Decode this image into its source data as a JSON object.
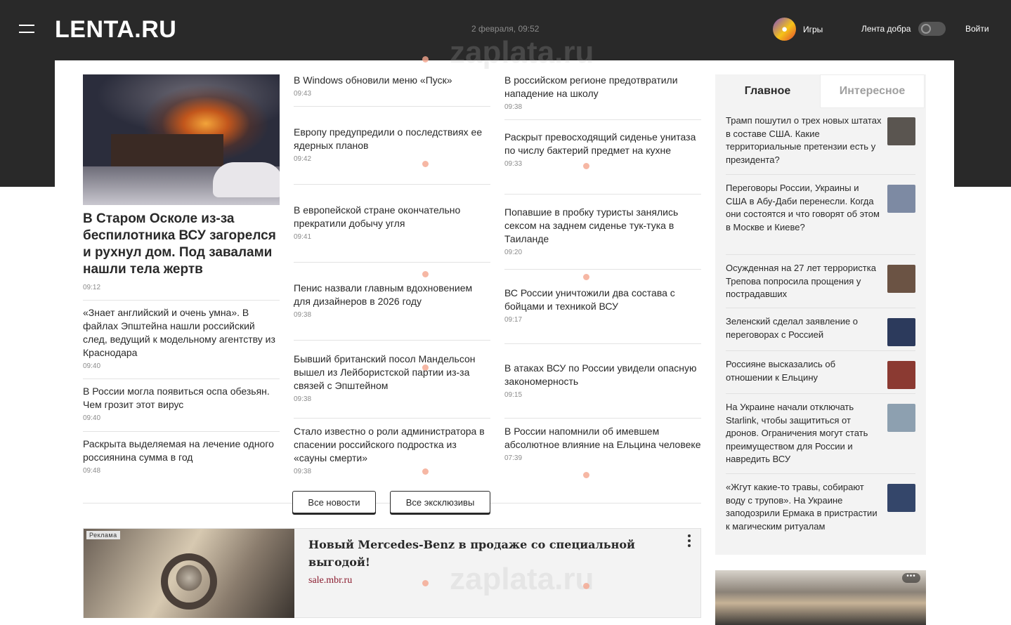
{
  "header": {
    "logo": "LENTA.RU",
    "date": "2 февраля, 09:52",
    "games_label": "Игры",
    "kindness_label": "Лента добра",
    "login_label": "Войти"
  },
  "watermark": "zaplata.ru",
  "lead": {
    "title": "В Старом Осколе из-за беспилотника ВСУ загорелся и рухнул дом. Под завалами нашли тела жертв",
    "time": "09:12"
  },
  "col1": [
    {
      "title": "«Знает английский и очень умна». В файлах Эпштейна нашли российский след, ведущий к модельному агентству из Краснодара",
      "time": "09:40"
    },
    {
      "title": "В России могла появиться оспа обезьян. Чем грозит этот вирус",
      "time": "09:40"
    },
    {
      "title": "Раскрыта выделяемая на лечение одного россиянина сумма в год",
      "time": "09:48"
    }
  ],
  "col2": [
    {
      "title": "В Windows обновили меню «Пуск»",
      "time": "09:43"
    },
    {
      "title": "Европу предупредили о последствиях ее ядерных планов",
      "time": "09:42"
    },
    {
      "title": "В европейской стране окончательно прекратили добычу угля",
      "time": "09:41"
    },
    {
      "title": "Пенис назвали главным вдохновением для дизайнеров в 2026 году",
      "time": "09:38"
    },
    {
      "title": "Бывший британский посол Мандельсон вышел из Лейбористской партии из-за связей с Эпштейном",
      "time": "09:38"
    },
    {
      "title": "Стало известно о роли администратора в спасении российского подростка из «сауны смерти»",
      "time": "09:38"
    }
  ],
  "col3": [
    {
      "title": "В российском регионе предотвратили нападение на школу",
      "time": "09:38"
    },
    {
      "title": "Раскрыт превосходящий сиденье унитаза по числу бактерий предмет на кухне",
      "time": "09:33"
    },
    {
      "title": "Попавшие в пробку туристы занялись сексом на заднем сиденье тук-тука в Таиланде",
      "time": "09:20"
    },
    {
      "title": "ВС России уничтожили два состава с бойцами и техникой ВСУ",
      "time": "09:17"
    },
    {
      "title": "В атаках ВСУ по России увидели опасную закономерность",
      "time": "09:15"
    },
    {
      "title": "В России напомнили об имевшем абсолютное влияние на Ельцина человеке",
      "time": "07:39"
    }
  ],
  "buttons": {
    "all_news": "Все новости",
    "all_exclusives": "Все эксклюзивы"
  },
  "ad": {
    "badge": "Реклама",
    "title": "Новый Mercedes-Benz в продаже со специальной выгодой!",
    "link": "sale.mbr.ru"
  },
  "side": {
    "tab_main": "Главное",
    "tab_interesting": "Интересное",
    "items": [
      {
        "title": "Трамп пошутил о трех новых штатах в составе США. Какие территориальные претензии есть у президента?",
        "thumb_color": "#5a5550"
      },
      {
        "title": "Переговоры России, Украины и США в Абу-Даби перенесли. Когда они состоятся и что говорят об этом в Москве и Киеве?",
        "thumb_color": "#7d8aa3"
      },
      {
        "title": "Осужденная на 27 лет террористка Трепова попросила прощения у пострадавших",
        "thumb_color": "#6b5344"
      },
      {
        "title": "Зеленский сделал заявление о переговорах с Россией",
        "thumb_color": "#2c3a5c"
      },
      {
        "title": "Россияне высказались об отношении к Ельцину",
        "thumb_color": "#8b3a32"
      },
      {
        "title": "На Украине начали отключать Starlink, чтобы защититься от дронов. Ограничения могут стать преимуществом для России и навредить ВСУ",
        "thumb_color": "#8da0b0"
      },
      {
        "title": "«Жгут какие-то травы, собирают воду с трупов». На Украине заподозрили Ермака в пристрастии к магическим ритуалам",
        "thumb_color": "#34466a"
      }
    ]
  },
  "colors": {
    "dark": "#292929",
    "panel": "#f3f3f3",
    "accent_link": "#8a1b2e"
  }
}
